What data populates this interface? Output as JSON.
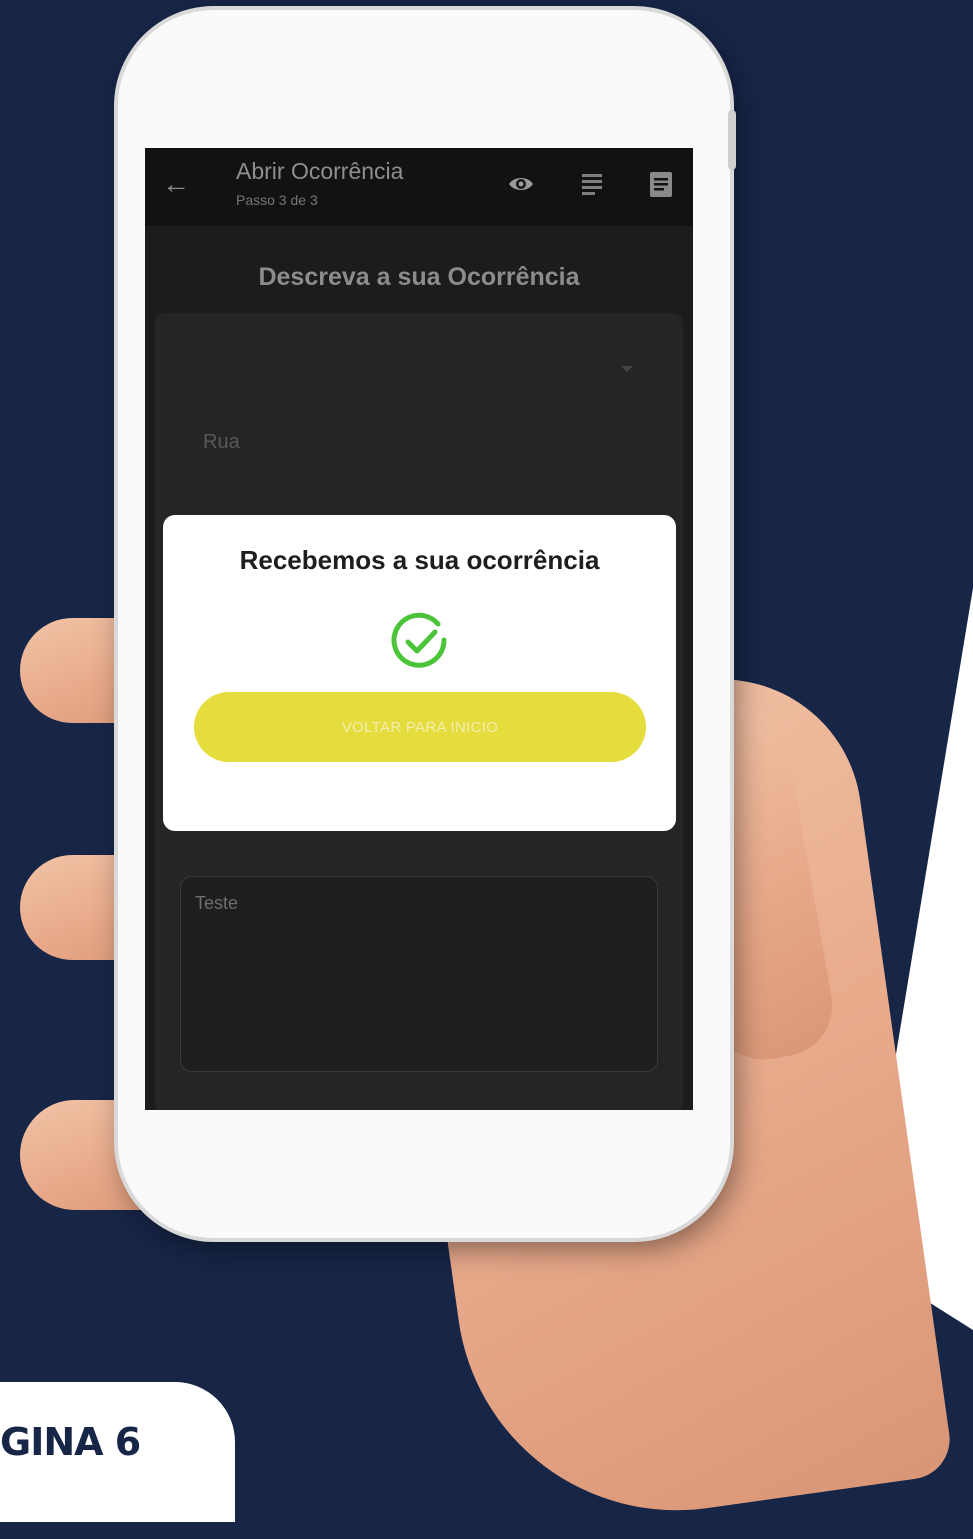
{
  "app": {
    "title": "Abrir Ocorrência",
    "subtitle": "Passo 3 de 3",
    "heading": "Descreva a sua Ocorrência"
  },
  "icons": {
    "back": "arrow-left-icon",
    "view": "eye-icon",
    "list": "list-icon",
    "document": "document-icon"
  },
  "form": {
    "street_placeholder": "Rua",
    "description_value": "Teste"
  },
  "dialog": {
    "title": "Recebemos a sua ocorrência",
    "button_label": "VOLTAR PARA INICIO",
    "status_icon": "check-circle-icon"
  },
  "badge": {
    "text": "GINA 6"
  },
  "colors": {
    "background": "#172547",
    "accent_button": "#e5dc3e",
    "success": "#4cc43a",
    "screen": "#1b1c1d"
  }
}
